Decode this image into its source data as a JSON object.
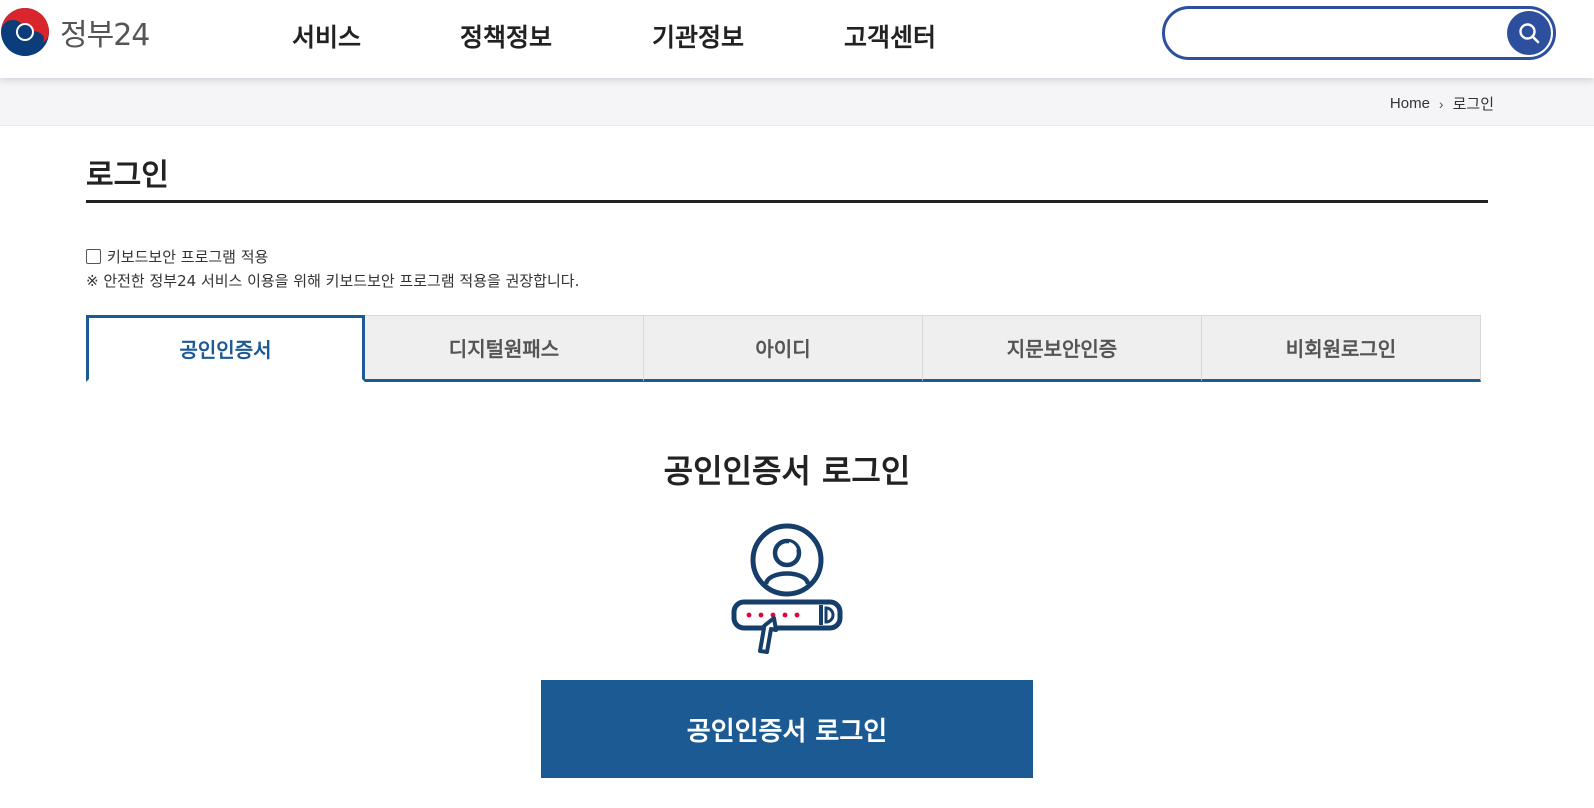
{
  "header": {
    "logo_text": "정부24",
    "nav": [
      "서비스",
      "정책정보",
      "기관정보",
      "고객센터"
    ],
    "search": {
      "value": "",
      "placeholder": ""
    }
  },
  "breadcrumb": {
    "home": "Home",
    "current": "로그인"
  },
  "page": {
    "title": "로그인",
    "keyboard_security_label": "키보드보안 프로그램 적용",
    "keyboard_security_checked": false,
    "keyboard_security_note": "※ 안전한 정부24 서비스 이용을 위해 키보드보안 프로그램 적용을 권장합니다."
  },
  "tabs": [
    {
      "label": "공인인증서",
      "active": true
    },
    {
      "label": "디지털원패스",
      "active": false
    },
    {
      "label": "아이디",
      "active": false
    },
    {
      "label": "지문보안인증",
      "active": false
    },
    {
      "label": "비회원로그인",
      "active": false
    }
  ],
  "main": {
    "section_title": "공인인증서 로그인",
    "login_button": "공인인증서 로그인",
    "illustration_icon": "user-password-login-icon"
  },
  "colors": {
    "primary": "#1b5a93",
    "search_border": "#2d4f9e",
    "accent_red": "#e4003a"
  }
}
